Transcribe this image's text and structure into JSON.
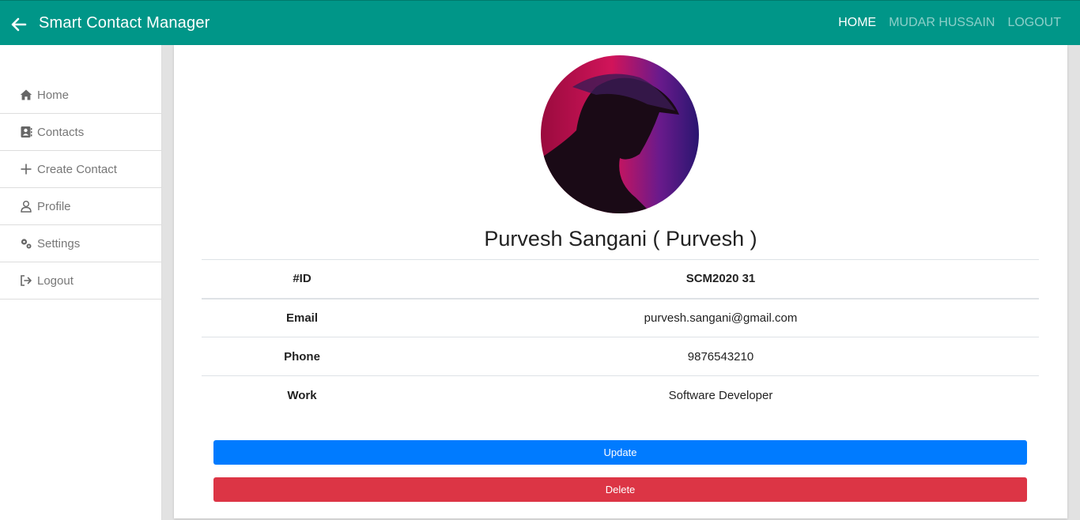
{
  "navbar": {
    "brand": "Smart Contact Manager",
    "links": [
      {
        "label": "HOME"
      },
      {
        "label": "MUDAR HUSSAIN"
      },
      {
        "label": "LOGOUT"
      }
    ]
  },
  "sidebar": {
    "items": [
      {
        "label": "Home",
        "icon": "home-icon"
      },
      {
        "label": "Contacts",
        "icon": "address-book-icon"
      },
      {
        "label": "Create Contact",
        "icon": "plus-icon"
      },
      {
        "label": "Profile",
        "icon": "user-icon"
      },
      {
        "label": "Settings",
        "icon": "gears-icon"
      },
      {
        "label": "Logout",
        "icon": "sign-out-icon"
      }
    ]
  },
  "contact": {
    "name": "Purvesh Sangani ( Purvesh )",
    "id_label": "#ID",
    "id_value": "SCM2020 31",
    "rows": [
      {
        "label": "Email",
        "value": "purvesh.sangani@gmail.com"
      },
      {
        "label": "Phone",
        "value": "9876543210"
      },
      {
        "label": "Work",
        "value": "Software Developer"
      }
    ]
  },
  "actions": {
    "update_label": "Update",
    "delete_label": "Delete"
  },
  "colors": {
    "navbar": "#009688",
    "update": "#007bff",
    "delete": "#dc3545"
  }
}
